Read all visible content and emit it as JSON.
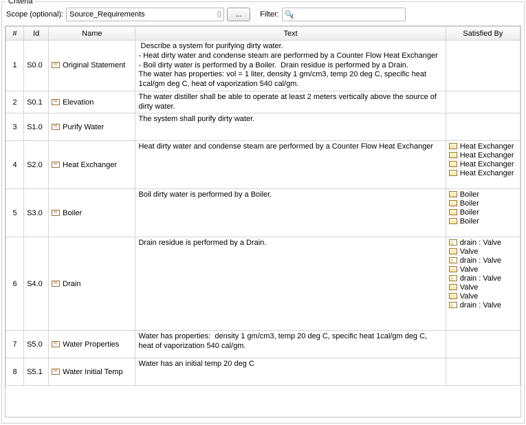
{
  "group_title": "Criteria",
  "toolbar": {
    "scope_label": "Scope (optional):",
    "scope_value": "Source_Requirements",
    "browse_label": "...",
    "filter_label": "Filter:",
    "filter_placeholder": ""
  },
  "columns": {
    "num": "#",
    "id": "Id",
    "name": "Name",
    "text": "Text",
    "satisfied": "Satisfied By"
  },
  "rows": [
    {
      "num": "1",
      "id": "S0.0",
      "name": "Original Statement",
      "text": " Describe a system for purifying dirty water.\n- Heat dirty water and condense steam are performed by a Counter Flow Heat Exchanger\n- Boil dirty water is performed by a Boiler.  Drain residue is performed by a Drain.\nThe water has properties: vol = 1 liter, density 1 gm/cm3, temp 20 deg C, specific heat 1cal/gm deg C, heat of vaporization 540 cal/gm.",
      "satisfied": []
    },
    {
      "num": "2",
      "id": "S0.1",
      "name": "Elevation",
      "text": "The water distiller shall be able to operate at least 2 meters vertically above the source of dirty water.",
      "satisfied": []
    },
    {
      "num": "3",
      "id": "S1.0",
      "name": "Purify Water",
      "text": "The system shall purify dirty water.",
      "satisfied": []
    },
    {
      "num": "4",
      "id": "S2.0",
      "name": "Heat Exchanger",
      "text": "Heat dirty water and condense steam are performed by a Counter Flow Heat Exchanger",
      "satisfied": [
        {
          "icon": "block",
          "label": "Heat Exchanger"
        },
        {
          "icon": "block",
          "label": "Heat Exchanger"
        },
        {
          "icon": "block",
          "label": "Heat Exchanger"
        },
        {
          "icon": "block",
          "label": "Heat Exchanger"
        }
      ]
    },
    {
      "num": "5",
      "id": "S3.0",
      "name": "Boiler",
      "text": "Boil dirty water is performed by a Boiler.",
      "satisfied": [
        {
          "icon": "block",
          "label": "Boiler"
        },
        {
          "icon": "block",
          "label": "Boiler"
        },
        {
          "icon": "block",
          "label": "Boiler"
        },
        {
          "icon": "block",
          "label": "Boiler"
        }
      ]
    },
    {
      "num": "6",
      "id": "S4.0",
      "name": "Drain",
      "text": "Drain residue is performed by a Drain.",
      "satisfied": [
        {
          "icon": "part",
          "label": "drain : Valve"
        },
        {
          "icon": "block",
          "label": "Valve"
        },
        {
          "icon": "part",
          "label": "drain : Valve"
        },
        {
          "icon": "block",
          "label": "Valve"
        },
        {
          "icon": "part",
          "label": "drain : Valve"
        },
        {
          "icon": "block",
          "label": "Valve"
        },
        {
          "icon": "block",
          "label": "Valve"
        },
        {
          "icon": "part",
          "label": "drain : Valve"
        }
      ]
    },
    {
      "num": "7",
      "id": "S5.0",
      "name": "Water Properties",
      "text": "Water has properties:  density 1 gm/cm3, temp 20 deg C, specific heat 1cal/gm deg C, heat of vaporization 540 cal/gm.",
      "satisfied": []
    },
    {
      "num": "8",
      "id": "S5.1",
      "name": "Water Initial Temp",
      "text": "Water has an initial temp 20 deg C",
      "satisfied": []
    }
  ]
}
